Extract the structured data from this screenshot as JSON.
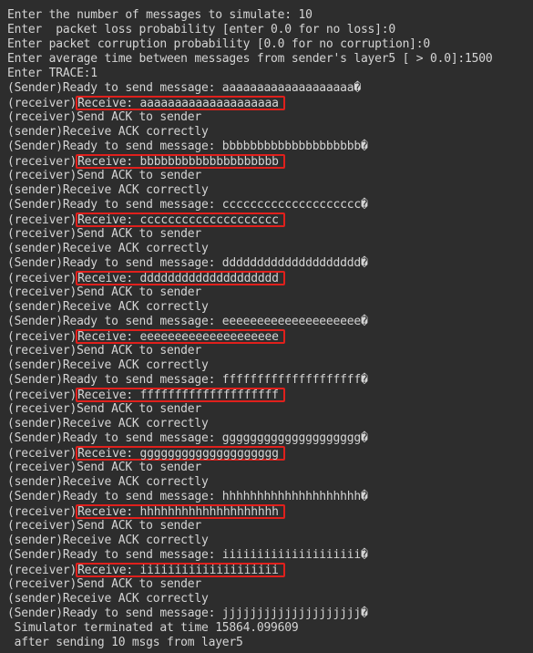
{
  "setup": [
    "Enter the number of messages to simulate: 10",
    "Enter  packet loss probability [enter 0.0 for no loss]:0",
    "Enter packet corruption probability [0.0 for no corruption]:0",
    "Enter average time between messages from sender's layer5 [ > 0.0]:1500",
    "Enter TRACE:1"
  ],
  "messages": [
    {
      "sender_ready": "(Sender)Ready to send message: aaaaaaaaaaaaaaaaaaa�",
      "recv_prefix": "(receiver)",
      "recv_text": "Receive: aaaaaaaaaaaaaaaaaaaa",
      "ack_send": "(receiver)Send ACK to sender",
      "ack_recv": "(sender)Receive ACK correctly"
    },
    {
      "sender_ready": "(Sender)Ready to send message: bbbbbbbbbbbbbbbbbbbb�",
      "recv_prefix": "(receiver)",
      "recv_text": "Receive: bbbbbbbbbbbbbbbbbbbb",
      "ack_send": "(receiver)Send ACK to sender",
      "ack_recv": "(sender)Receive ACK correctly"
    },
    {
      "sender_ready": "(Sender)Ready to send message: cccccccccccccccccccc�",
      "recv_prefix": "(receiver)",
      "recv_text": "Receive: cccccccccccccccccccc",
      "ack_send": "(receiver)Send ACK to sender",
      "ack_recv": "(sender)Receive ACK correctly"
    },
    {
      "sender_ready": "(Sender)Ready to send message: dddddddddddddddddddd�",
      "recv_prefix": "(receiver)",
      "recv_text": "Receive: dddddddddddddddddddd",
      "ack_send": "(receiver)Send ACK to sender",
      "ack_recv": "(sender)Receive ACK correctly"
    },
    {
      "sender_ready": "(Sender)Ready to send message: eeeeeeeeeeeeeeeeeeee�",
      "recv_prefix": "(receiver)",
      "recv_text": "Receive: eeeeeeeeeeeeeeeeeeee",
      "ack_send": "(receiver)Send ACK to sender",
      "ack_recv": "(sender)Receive ACK correctly"
    },
    {
      "sender_ready": "(Sender)Ready to send message: ffffffffffffffffffff�",
      "recv_prefix": "(receiver)",
      "recv_text": "Receive: ffffffffffffffffffff",
      "ack_send": "(receiver)Send ACK to sender",
      "ack_recv": "(sender)Receive ACK correctly"
    },
    {
      "sender_ready": "(Sender)Ready to send message: gggggggggggggggggggg�",
      "recv_prefix": "(receiver)",
      "recv_text": "Receive: gggggggggggggggggggg",
      "ack_send": "(receiver)Send ACK to sender",
      "ack_recv": "(sender)Receive ACK correctly"
    },
    {
      "sender_ready": "(Sender)Ready to send message: hhhhhhhhhhhhhhhhhhhh�",
      "recv_prefix": "(receiver)",
      "recv_text": "Receive: hhhhhhhhhhhhhhhhhhhh",
      "ack_send": "(receiver)Send ACK to sender",
      "ack_recv": "(sender)Receive ACK correctly"
    },
    {
      "sender_ready": "(Sender)Ready to send message: iiiiiiiiiiiiiiiiiiii�",
      "recv_prefix": "(receiver)",
      "recv_text": "Receive: iiiiiiiiiiiiiiiiiiii",
      "ack_send": "(receiver)Send ACK to sender",
      "ack_recv": "(sender)Receive ACK correctly"
    }
  ],
  "last_ready": "(Sender)Ready to send message: jjjjjjjjjjjjjjjjjjjj�",
  "footer": [
    " Simulator terminated at time 15864.099609",
    " after sending 10 msgs from layer5"
  ],
  "colors": {
    "background": "#2d2d2d",
    "text": "#d4d4d4",
    "highlight_box": "#e0201c"
  }
}
